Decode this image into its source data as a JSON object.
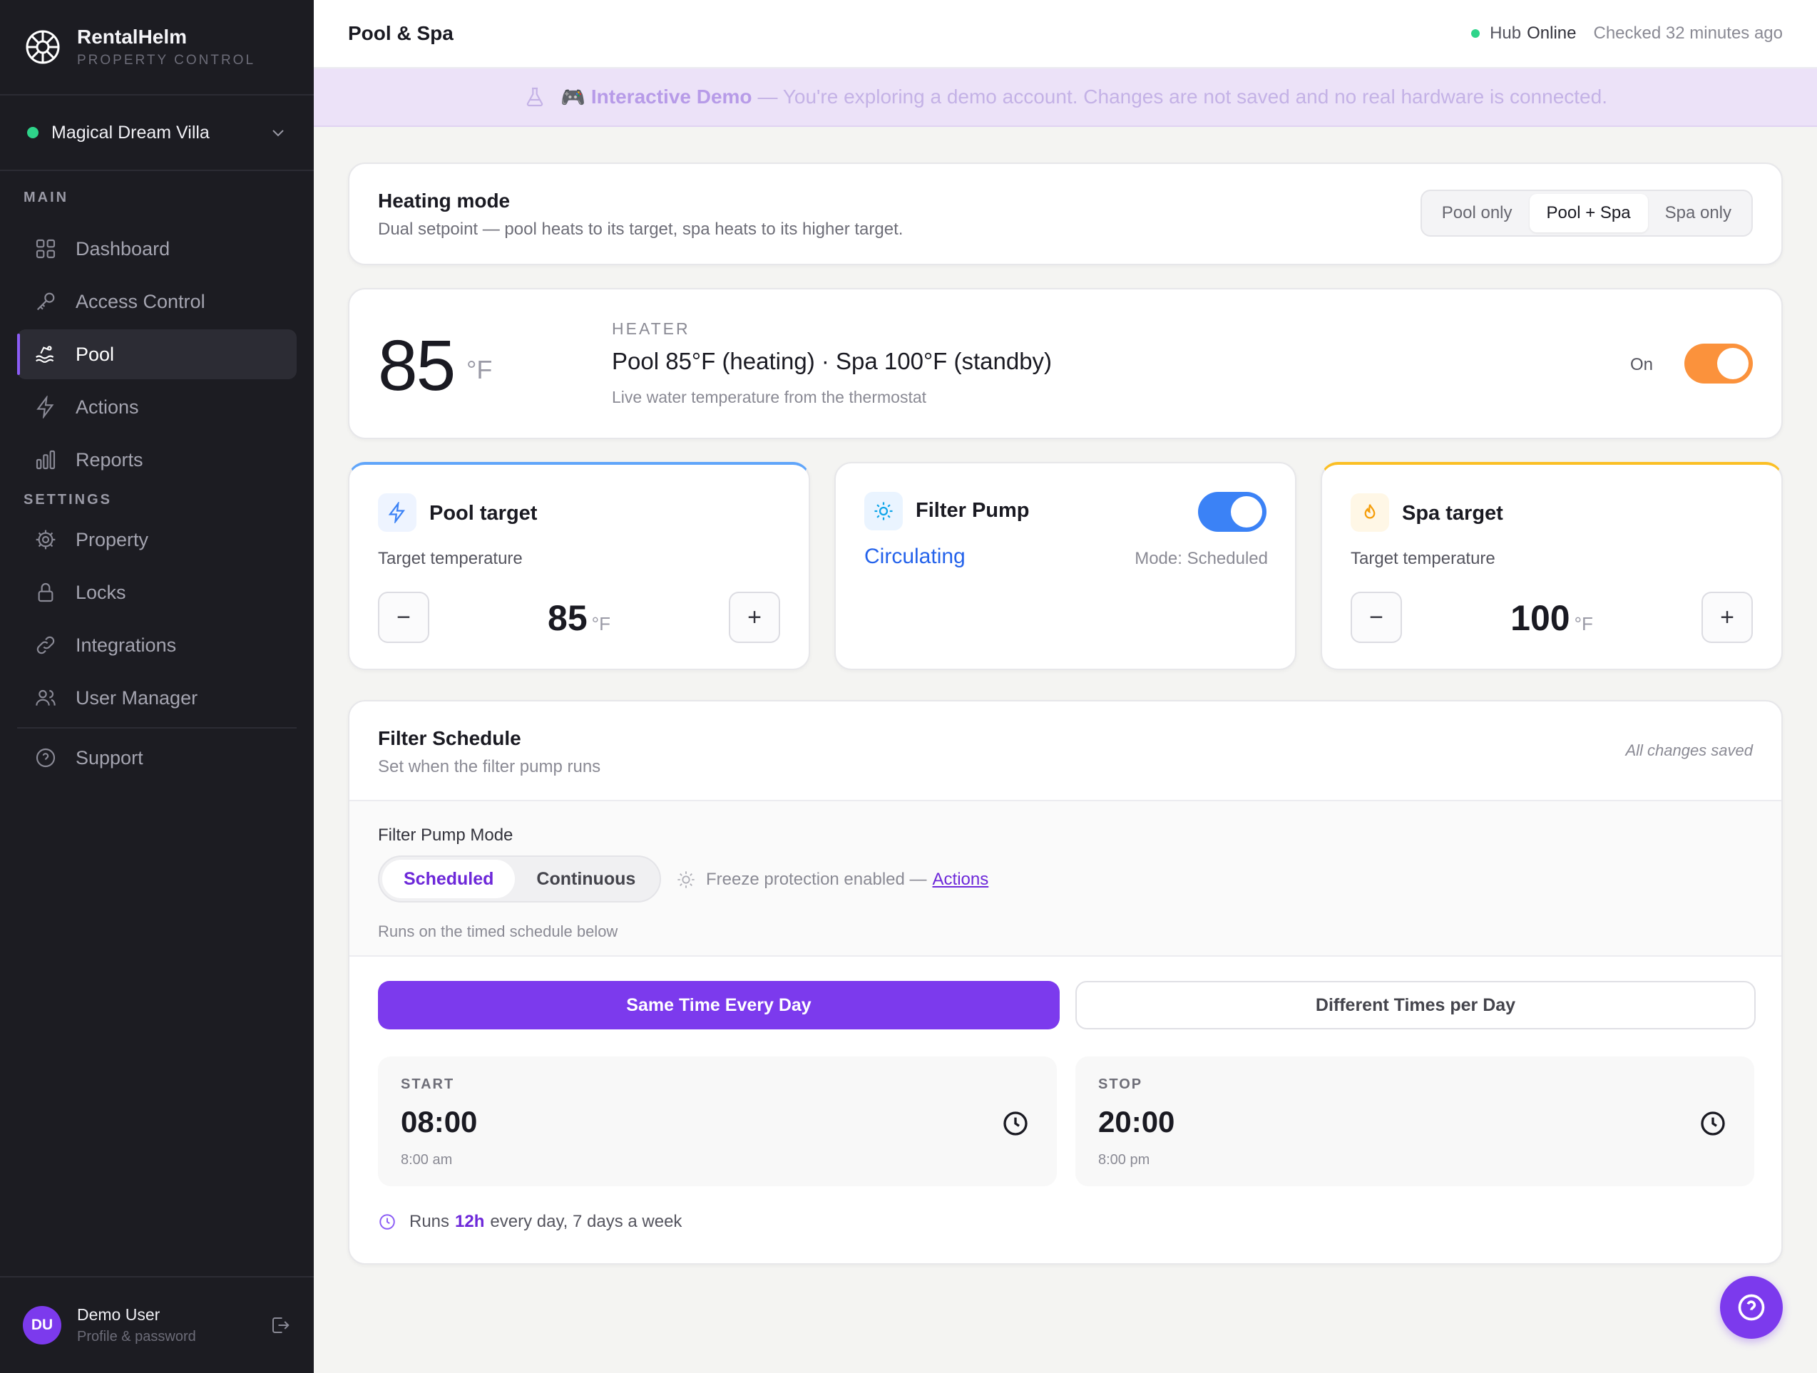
{
  "app": {
    "name": "RentalHelm",
    "tagline": "PROPERTY CONTROL"
  },
  "property": {
    "name": "Magical Dream Villa",
    "status_color": "#2ed48a"
  },
  "sidebar": {
    "main_section": "MAIN",
    "settings_section": "SETTINGS",
    "items": [
      {
        "label": "Dashboard",
        "icon": "grid-icon"
      },
      {
        "label": "Access Control",
        "icon": "key-icon"
      },
      {
        "label": "Pool",
        "icon": "waves-icon",
        "active": true
      },
      {
        "label": "Actions",
        "icon": "lightning-icon"
      },
      {
        "label": "Reports",
        "icon": "bar-chart-icon"
      },
      {
        "label": "Property",
        "icon": "gear-icon"
      },
      {
        "label": "Locks",
        "icon": "lock-icon"
      },
      {
        "label": "Integrations",
        "icon": "link-icon"
      },
      {
        "label": "User Manager",
        "icon": "users-icon"
      },
      {
        "label": "Support",
        "icon": "help-circle-icon"
      }
    ]
  },
  "user": {
    "initials": "DU",
    "name": "Demo User",
    "sub": "Profile & password"
  },
  "header": {
    "title": "Pool & Spa",
    "hub_label": "Hub",
    "hub_status": "Online",
    "checked": "Checked 32 minutes ago"
  },
  "banner": {
    "emoji": "🎮",
    "bold": "Interactive Demo",
    "text": "— You're exploring a demo account. Changes are not saved and no real hardware is connected."
  },
  "heating_mode": {
    "title": "Heating mode",
    "description": "Dual setpoint — pool heats to its target, spa heats to its higher target.",
    "options": [
      "Pool only",
      "Pool + Spa",
      "Spa only"
    ],
    "selected": "Pool + Spa"
  },
  "heater": {
    "temp": "85",
    "unit": "°F",
    "label": "HEATER",
    "status": "Pool 85°F (heating) · Spa 100°F (standby)",
    "sub": "Live water temperature from the thermostat",
    "toggle_label": "On",
    "on": true
  },
  "pool_target": {
    "title": "Pool target",
    "sub": "Target temperature",
    "value": "85",
    "unit": "°F",
    "accent": "#60a5fa"
  },
  "filter_pump": {
    "title": "Filter Pump",
    "status": "Circulating",
    "mode": "Mode: Scheduled",
    "on": true
  },
  "spa_target": {
    "title": "Spa target",
    "sub": "Target temperature",
    "value": "100",
    "unit": "°F",
    "accent": "#fbbf24"
  },
  "steppers": {
    "minus": "−",
    "plus": "+"
  },
  "schedule": {
    "title": "Filter Schedule",
    "sub": "Set when the filter pump runs",
    "saved": "All changes saved",
    "mode_label": "Filter Pump Mode",
    "modes": [
      "Scheduled",
      "Continuous"
    ],
    "mode_selected": "Scheduled",
    "freeze_text": "Freeze protection enabled —",
    "freeze_link": "Actions",
    "mode_hint": "Runs on the timed schedule below",
    "same_time": "Same Time Every Day",
    "different_times": "Different Times per Day",
    "start": {
      "label": "START",
      "time": "08:00",
      "sub": "8:00 am"
    },
    "stop": {
      "label": "STOP",
      "time": "20:00",
      "sub": "8:00 pm"
    },
    "runs_prefix": "Runs",
    "runs_hours": "12h",
    "runs_suffix": "every day, 7 days a week"
  },
  "colors": {
    "accent_purple": "#7c3aed",
    "toggle_orange": "#fb923c",
    "toggle_blue": "#3b82f6"
  }
}
